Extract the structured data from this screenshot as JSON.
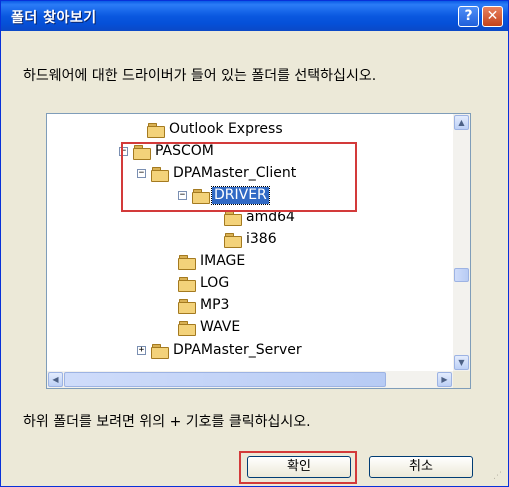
{
  "window": {
    "title": "폴더 찾아보기",
    "help_symbol": "?",
    "close_symbol": "✕"
  },
  "instruction": "하드웨어에 대한 드라이버가 들어 있는 폴더를 선택하십시오.",
  "tree": {
    "items": [
      {
        "label": "Outlook Express",
        "expander": "",
        "selected": false
      },
      {
        "label": "PASCOM",
        "expander": "−",
        "selected": false
      },
      {
        "label": "DPAMaster_Client",
        "expander": "−",
        "selected": false
      },
      {
        "label": "DRIVER",
        "expander": "−",
        "selected": true
      },
      {
        "label": "amd64",
        "expander": "",
        "selected": false
      },
      {
        "label": "i386",
        "expander": "",
        "selected": false
      },
      {
        "label": "IMAGE",
        "expander": "",
        "selected": false
      },
      {
        "label": "LOG",
        "expander": "",
        "selected": false
      },
      {
        "label": "MP3",
        "expander": "",
        "selected": false
      },
      {
        "label": "WAVE",
        "expander": "",
        "selected": false
      },
      {
        "label": "DPAMaster_Server",
        "expander": "+",
        "selected": false
      }
    ]
  },
  "hint": "하위 폴더를 보려면 위의 + 기호를 클릭하십시오.",
  "buttons": {
    "ok": "확인",
    "cancel": "취소"
  },
  "colors": {
    "highlight": "#d33a3a",
    "selection": "#316ac5"
  }
}
